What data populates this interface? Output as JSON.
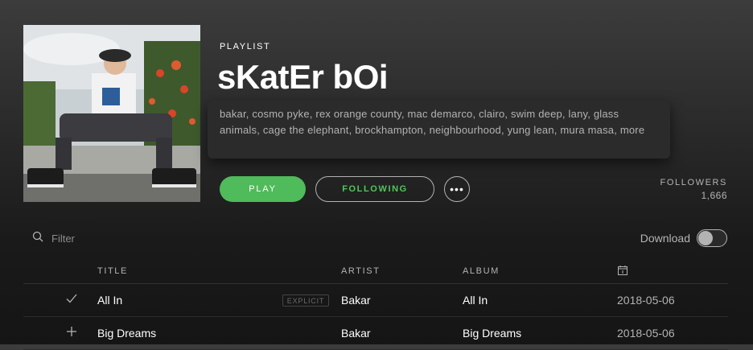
{
  "playlist": {
    "type_label": "PLAYLIST",
    "title": "sKatEr bOi",
    "description": "bakar, cosmo pyke, rex orange county, mac demarco, clairo, swim deep, lany, glass animals, cage the elephant, brockhampton, neighbourhood, yung lean, mura masa, more"
  },
  "actions": {
    "play_label": "PLAY",
    "follow_label": "FOLLOWING",
    "more_label": "•••"
  },
  "followers": {
    "label": "FOLLOWERS",
    "count": "1,666"
  },
  "toolbar": {
    "filter_placeholder": "Filter",
    "download_label": "Download",
    "download_enabled": false
  },
  "table": {
    "headers": {
      "title": "TITLE",
      "artist": "ARTIST",
      "album": "ALBUM",
      "date_icon": "calendar-icon"
    },
    "rows": [
      {
        "icon": "check-icon",
        "title": "All In",
        "explicit": "EXPLICIT",
        "artist": "Bakar",
        "album": "All In",
        "date": "2018-05-06"
      },
      {
        "icon": "plus-icon",
        "title": "Big Dreams",
        "explicit": "",
        "artist": "Bakar",
        "album": "Big Dreams",
        "date": "2018-05-06"
      }
    ]
  },
  "colors": {
    "accent_green": "#4fbb5a",
    "following_text": "#54c45e",
    "muted_text": "#b3b3b3"
  }
}
